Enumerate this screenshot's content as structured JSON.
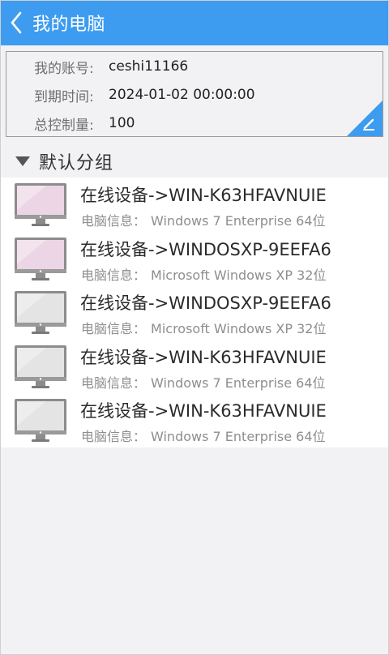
{
  "header": {
    "title": "我的电脑",
    "back_icon": "chevron-left-icon",
    "background": "#3d9cf0"
  },
  "account": {
    "account_label": "我的账号:",
    "account_value": "ceshi11166",
    "expire_label": "到期时间:",
    "expire_value": "2024-01-02 00:00:00",
    "total_label": "总控制量:",
    "total_value": "100",
    "edit_icon": "pencil-icon",
    "accent": "#3d9cf0"
  },
  "group": {
    "title": "默认分组",
    "expand_icon": "triangle-down-icon"
  },
  "devices": [
    {
      "name": "在线设备->WIN-K63HFAVNUIE",
      "info_label": "电脑信息：",
      "info_value": "Windows 7 Enterprise 64位",
      "status": "highlighted"
    },
    {
      "name": "在线设备->WINDOSXP-9EEFA6",
      "info_label": "电脑信息：",
      "info_value": "Microsoft Windows XP 32位",
      "status": "highlighted"
    },
    {
      "name": "在线设备->WINDOSXP-9EEFA6",
      "info_label": "电脑信息：",
      "info_value": "Microsoft Windows XP 32位",
      "status": "normal"
    },
    {
      "name": "在线设备->WIN-K63HFAVNUIE",
      "info_label": "电脑信息：",
      "info_value": "Windows 7 Enterprise 64位",
      "status": "normal"
    },
    {
      "name": "在线设备->WIN-K63HFAVNUIE",
      "info_label": "电脑信息：",
      "info_value": "Windows 7 Enterprise 64位",
      "status": "normal"
    }
  ]
}
